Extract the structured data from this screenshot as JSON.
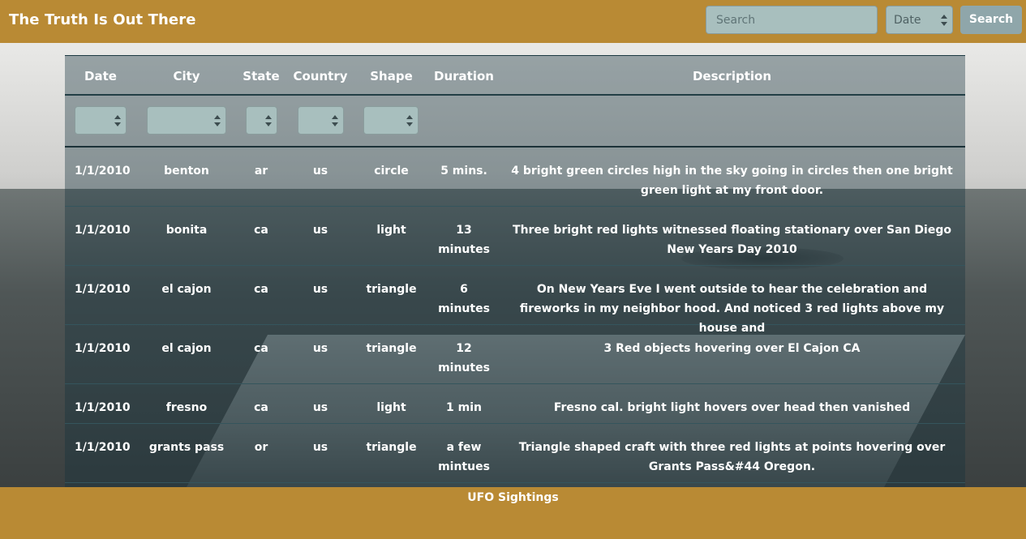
{
  "navbar": {
    "title": "The Truth Is Out There",
    "search_placeholder": "Search",
    "search_type_selected": "Date",
    "search_button": "Search"
  },
  "table": {
    "headers": {
      "date": "Date",
      "city": "City",
      "state": "State",
      "country": "Country",
      "shape": "Shape",
      "duration": "Duration",
      "description": "Description"
    },
    "rows": [
      {
        "date": "1/1/2010",
        "city": "benton",
        "state": "ar",
        "country": "us",
        "shape": "circle",
        "duration": "5 mins.",
        "description": "4 bright green circles high in the sky going in circles then one bright green light at my front door."
      },
      {
        "date": "1/1/2010",
        "city": "bonita",
        "state": "ca",
        "country": "us",
        "shape": "light",
        "duration": "13 minutes",
        "description": "Three bright red lights witnessed floating stationary over San Diego New Years Day 2010"
      },
      {
        "date": "1/1/2010",
        "city": "el cajon",
        "state": "ca",
        "country": "us",
        "shape": "triangle",
        "duration": "6 minutes",
        "description": "On New Years Eve I went outside to hear the celebration and fireworks in my neighbor hood. And noticed 3 red lights above my house and"
      },
      {
        "date": "1/1/2010",
        "city": "el cajon",
        "state": "ca",
        "country": "us",
        "shape": "triangle",
        "duration": "12 minutes",
        "description": "3 Red objects hovering over El Cajon CA"
      },
      {
        "date": "1/1/2010",
        "city": "fresno",
        "state": "ca",
        "country": "us",
        "shape": "light",
        "duration": "1 min",
        "description": "Fresno cal. bright light hovers over head then vanished"
      },
      {
        "date": "1/1/2010",
        "city": "grants pass",
        "state": "or",
        "country": "us",
        "shape": "triangle",
        "duration": "a few mintues",
        "description": "Triangle shaped craft with three red lights at points hovering over Grants Pass&#44 Oregon."
      }
    ]
  },
  "footer": {
    "text": "UFO Sightings"
  },
  "colors": {
    "brand": "#b98a34",
    "input_background": "#a8bfbe",
    "button_background": "#8fa6aa"
  }
}
